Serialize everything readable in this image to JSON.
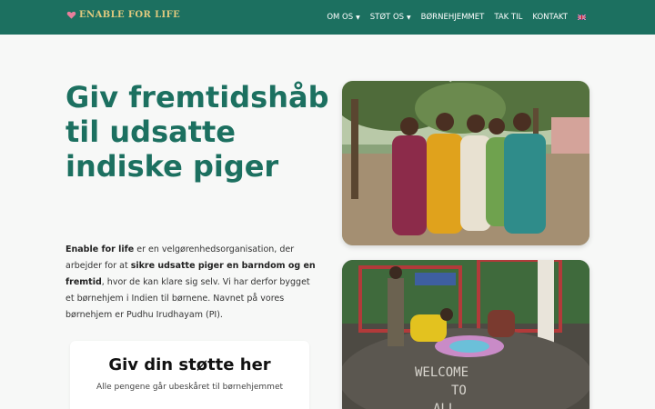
{
  "brand": {
    "name": "ENABLE FOR LIFE"
  },
  "nav": {
    "items": [
      {
        "label": "OM OS",
        "dropdown": true
      },
      {
        "label": "STØT OS",
        "dropdown": true
      },
      {
        "label": "BØRNEHJEMMET",
        "dropdown": false
      },
      {
        "label": "TAK TIL",
        "dropdown": false
      },
      {
        "label": "KONTAKT",
        "dropdown": false
      }
    ],
    "language_icon": "uk-flag-icon"
  },
  "hero": {
    "title": "Giv fremtidshåb til udsatte indiske piger",
    "desc_part1": "Enable for life",
    "desc_part2": " er en velgørenhedsorganisation, der arbejder for at ",
    "desc_part3": "sikre udsatte piger en barndom og en fremtid",
    "desc_part4": ", hvor de kan klare sig selv. Vi har derfor bygget et børnehjem i Indien til børnene. Navnet på vores børnehjem er Pudhu Irudhayam (PI)."
  },
  "support": {
    "title": "Giv din støtte her",
    "subtitle": "Alle pengene går ubeskåret til børnehjemmet"
  },
  "photos": {
    "ground_text_line1": "WELCOME",
    "ground_text_line2": "TO",
    "ground_text_line3": "ALL"
  },
  "colors": {
    "header_bg": "#1c7060",
    "accent_green": "#1c7060",
    "logo_gold": "#e0c97e",
    "logo_heart": "#e87f9c",
    "page_bg": "#f7f8f7"
  }
}
